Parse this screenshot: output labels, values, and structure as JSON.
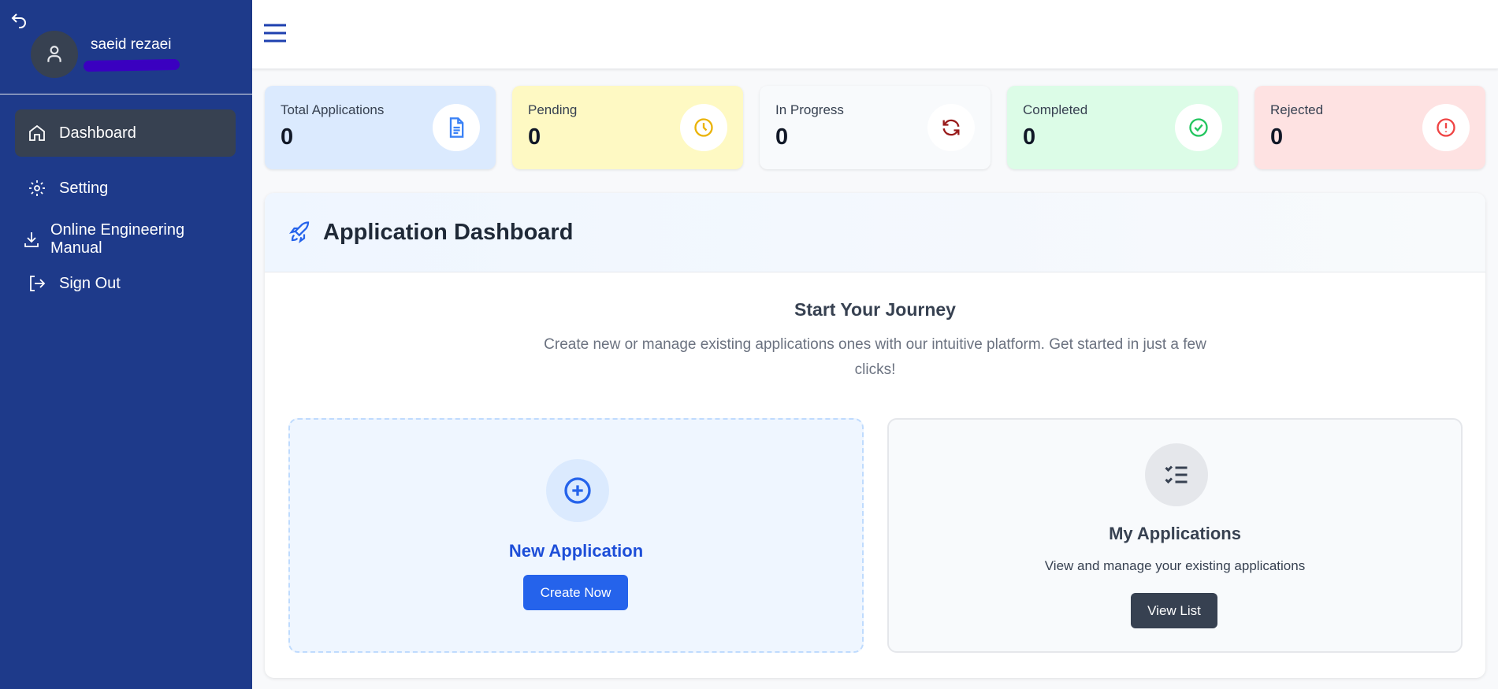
{
  "user": {
    "name": "saeid rezaei"
  },
  "sidebar": {
    "items": [
      {
        "label": "Dashboard",
        "icon": "home-icon"
      },
      {
        "label": "Setting",
        "icon": "gear-icon"
      },
      {
        "label": "Online Engineering Manual",
        "icon": "download-icon"
      },
      {
        "label": "Sign Out",
        "icon": "sign-out-icon"
      }
    ]
  },
  "stats": [
    {
      "label": "Total Applications",
      "value": "0",
      "bg": "#dbeafe",
      "color": "#3b82f6"
    },
    {
      "label": "Pending",
      "value": "0",
      "bg": "#fef9c3",
      "color": "#eab308"
    },
    {
      "label": "In Progress",
      "value": "0",
      "bg": "#f8fafc",
      "color": "#991b1b"
    },
    {
      "label": "Completed",
      "value": "0",
      "bg": "#dcfce7",
      "color": "#22c55e"
    },
    {
      "label": "Rejected",
      "value": "0",
      "bg": "#fee2e2",
      "color": "#ef4444"
    }
  ],
  "panel": {
    "title": "Application Dashboard",
    "subtitle": "Start Your Journey",
    "description": "Create new or manage existing applications ones with our intuitive platform. Get started in just a few clicks!",
    "new_app": {
      "title": "New Application",
      "button": "Create Now"
    },
    "my_apps": {
      "title": "My Applications",
      "text": "View and manage your existing applications",
      "button": "View List"
    }
  }
}
